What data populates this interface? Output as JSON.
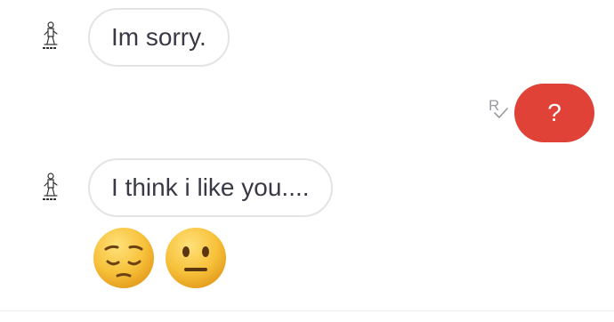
{
  "messages": [
    {
      "direction": "incoming",
      "text": "Im sorry.",
      "avatar": "sketch-figure-avatar-icon"
    },
    {
      "direction": "outgoing",
      "text": "?",
      "receipt": "R",
      "receipt_icon": "read-check-icon",
      "bubble_color": "#e04238"
    },
    {
      "direction": "incoming",
      "text": "I think i like you....",
      "avatar": "sketch-figure-avatar-icon"
    },
    {
      "direction": "incoming",
      "emojis": [
        "pensive-face-emoji",
        "neutral-face-emoji"
      ]
    }
  ],
  "colors": {
    "incoming_border": "#e4e4e7",
    "incoming_text": "#3a3a46",
    "outgoing_bubble": "#e04238",
    "emoji_face": "#f7c13a"
  }
}
